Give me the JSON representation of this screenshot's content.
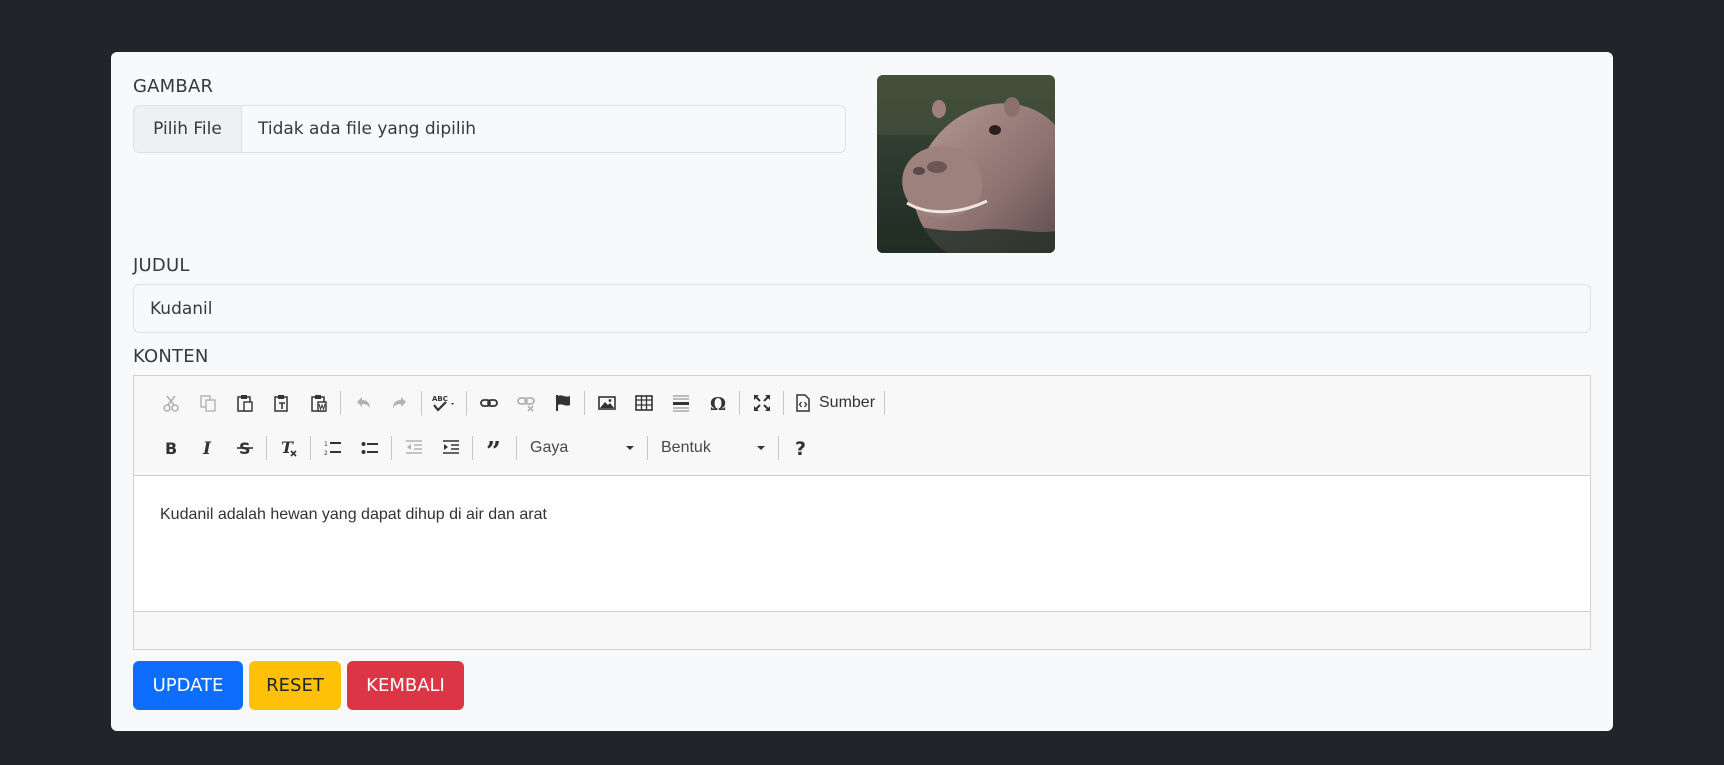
{
  "form": {
    "image_label": "GAMBAR",
    "file_button": "Pilih File",
    "file_status": "Tidak ada file yang dipilih",
    "title_label": "JUDUL",
    "title_value": "Kudanil",
    "content_label": "KONTEN"
  },
  "editor": {
    "source_label": "Sumber",
    "style_combo": "Gaya",
    "format_combo": "Bentuk",
    "content_text": "Kudanil adalah hewan yang dapat dihup di air dan arat"
  },
  "buttons": {
    "update": "UPDATE",
    "reset": "RESET",
    "back": "KEMBALI"
  },
  "colors": {
    "background": "#212529",
    "card": "#f8f9fa",
    "primary": "#0d6efd",
    "warning": "#ffc107",
    "danger": "#dc3545"
  }
}
